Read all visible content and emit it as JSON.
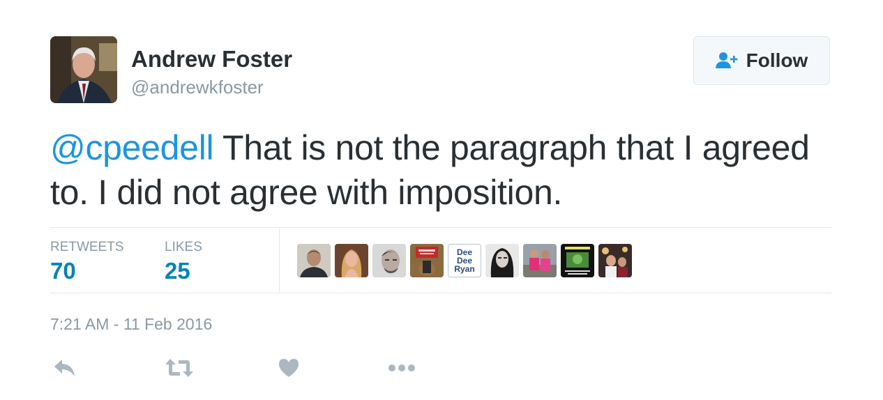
{
  "user": {
    "name": "Andrew Foster",
    "handle": "@andrewkfoster"
  },
  "follow_button": {
    "label": "Follow",
    "icon": "add-user-icon"
  },
  "tweet": {
    "mention": "@cpeedell",
    "text": " That is not the paragraph that I agreed to. I did not agree with imposition."
  },
  "stats": {
    "retweets_label": "RETWEETS",
    "retweets_value": "70",
    "likes_label": "LIKES",
    "likes_value": "25"
  },
  "likers": [
    {
      "kind": "photo"
    },
    {
      "kind": "photo"
    },
    {
      "kind": "photo"
    },
    {
      "kind": "photo"
    },
    {
      "kind": "text",
      "text": "Dee Dee Ryan"
    },
    {
      "kind": "photo"
    },
    {
      "kind": "photo"
    },
    {
      "kind": "photo"
    },
    {
      "kind": "photo"
    }
  ],
  "timestamp": "7:21 AM - 11 Feb 2016",
  "actions": [
    {
      "name": "reply",
      "icon": "reply-icon"
    },
    {
      "name": "retweet",
      "icon": "retweet-icon"
    },
    {
      "name": "like",
      "icon": "heart-icon"
    },
    {
      "name": "more",
      "icon": "more-icon"
    }
  ],
  "colors": {
    "accent": "#1b95e0",
    "stat_value": "#0084b4",
    "muted": "#8899a6",
    "text": "#292f33",
    "divider": "#e1e8ed",
    "action_icon": "#aab8c2"
  }
}
